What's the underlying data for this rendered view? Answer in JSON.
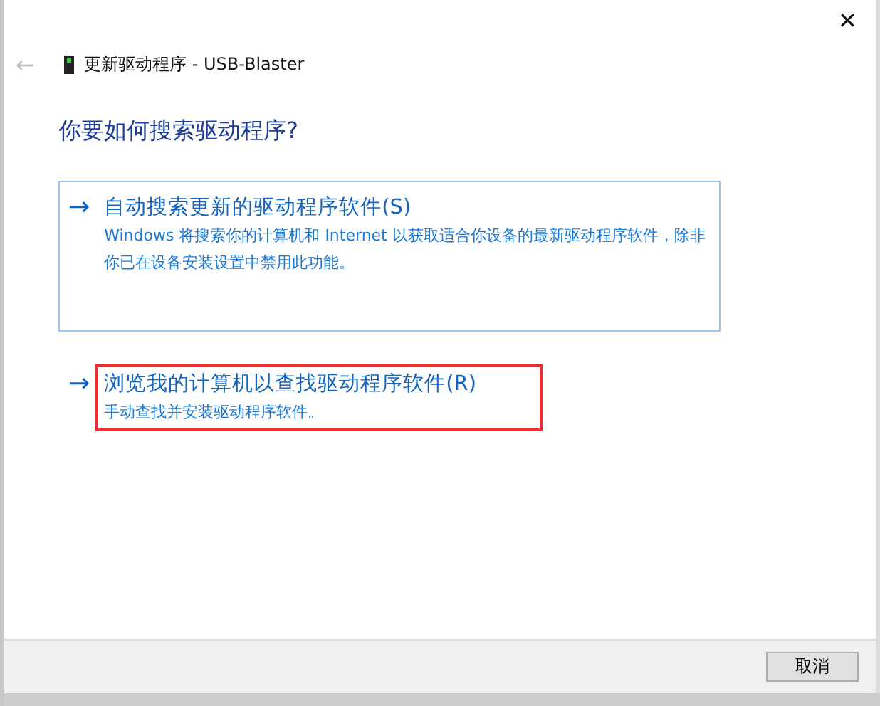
{
  "window": {
    "title": "更新驱动程序 - USB-Blaster",
    "close": "✕",
    "back": "←"
  },
  "heading": "你要如何搜索驱动程序?",
  "options": [
    {
      "arrow": "→",
      "title": "自动搜索更新的驱动程序软件(S)",
      "description": "Windows 将搜索你的计算机和 Internet 以获取适合你设备的最新驱动程序软件，除非你已在设备安装设置中禁用此功能。",
      "selected": true,
      "highlighted": false
    },
    {
      "arrow": "→",
      "title": "浏览我的计算机以查找驱动程序软件(R)",
      "description": "手动查找并安装驱动程序软件。",
      "selected": false,
      "highlighted": true
    }
  ],
  "buttons": [
    "取消"
  ]
}
